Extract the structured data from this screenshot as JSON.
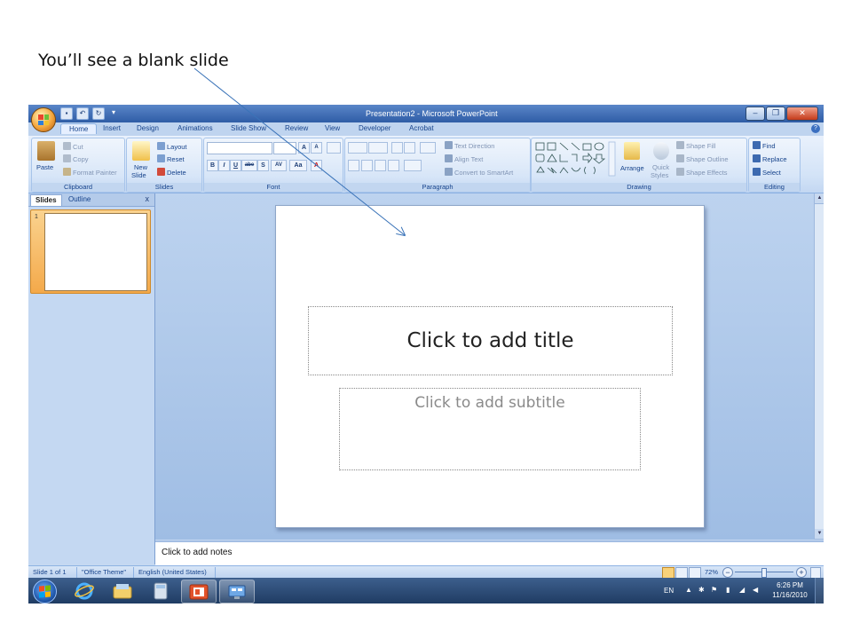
{
  "caption": "You’ll see a blank slide",
  "window": {
    "title": "Presentation2 - Microsoft PowerPoint",
    "controls": {
      "minimize": "–",
      "restore": "❐",
      "close": "✕"
    }
  },
  "quick_access": {
    "save": "▪",
    "undo": "↶",
    "redo": "↻",
    "customize": "▾"
  },
  "tabs": [
    "Home",
    "Insert",
    "Design",
    "Animations",
    "Slide Show",
    "Review",
    "View",
    "Developer",
    "Acrobat"
  ],
  "help_icon": "?",
  "ribbon": {
    "clipboard": {
      "paste": "Paste",
      "cut": "Cut",
      "copy": "Copy",
      "format_painter": "Format Painter",
      "label": "Clipboard"
    },
    "slides": {
      "new_slide_line1": "New",
      "new_slide_line2": "Slide",
      "layout": "Layout",
      "reset": "Reset",
      "delete": "Delete",
      "label": "Slides"
    },
    "font": {
      "label": "Font",
      "grow": "A",
      "shrink": "A",
      "bold": "B",
      "italic": "I",
      "underline": "U",
      "strike": "abe",
      "shadow": "S",
      "spacing": "AV",
      "case": "Aa",
      "color": "A"
    },
    "paragraph": {
      "text_direction": "Text Direction",
      "align_text": "Align Text",
      "convert_smartart": "Convert to SmartArt",
      "label": "Paragraph"
    },
    "drawing": {
      "arrange": "Arrange",
      "quick_styles_1": "Quick",
      "quick_styles_2": "Styles",
      "shape_fill": "Shape Fill",
      "shape_outline": "Shape Outline",
      "shape_effects": "Shape Effects",
      "label": "Drawing"
    },
    "editing": {
      "find": "Find",
      "replace": "Replace",
      "select": "Select",
      "label": "Editing"
    }
  },
  "left_pane": {
    "tab_slides": "Slides",
    "tab_outline": "Outline",
    "close": "x",
    "slide_number": "1"
  },
  "slide": {
    "title_placeholder": "Click to add title",
    "subtitle_placeholder": "Click to add subtitle"
  },
  "notes_placeholder": "Click to add notes",
  "status": {
    "slide_count": "Slide 1 of 1",
    "theme": "\"Office Theme\"",
    "language": "English (United States)",
    "zoom": "72%",
    "zoom_minus": "−",
    "zoom_plus": "+"
  },
  "zoom_fraction": 0.5,
  "taskbar": {
    "tray_lang": "EN",
    "time": "6:26 PM",
    "date": "11/16/2010"
  },
  "colors": {
    "ribbon_text": "#15428b",
    "selection": "#f4a94a",
    "office_orange": "#f3a53c"
  }
}
